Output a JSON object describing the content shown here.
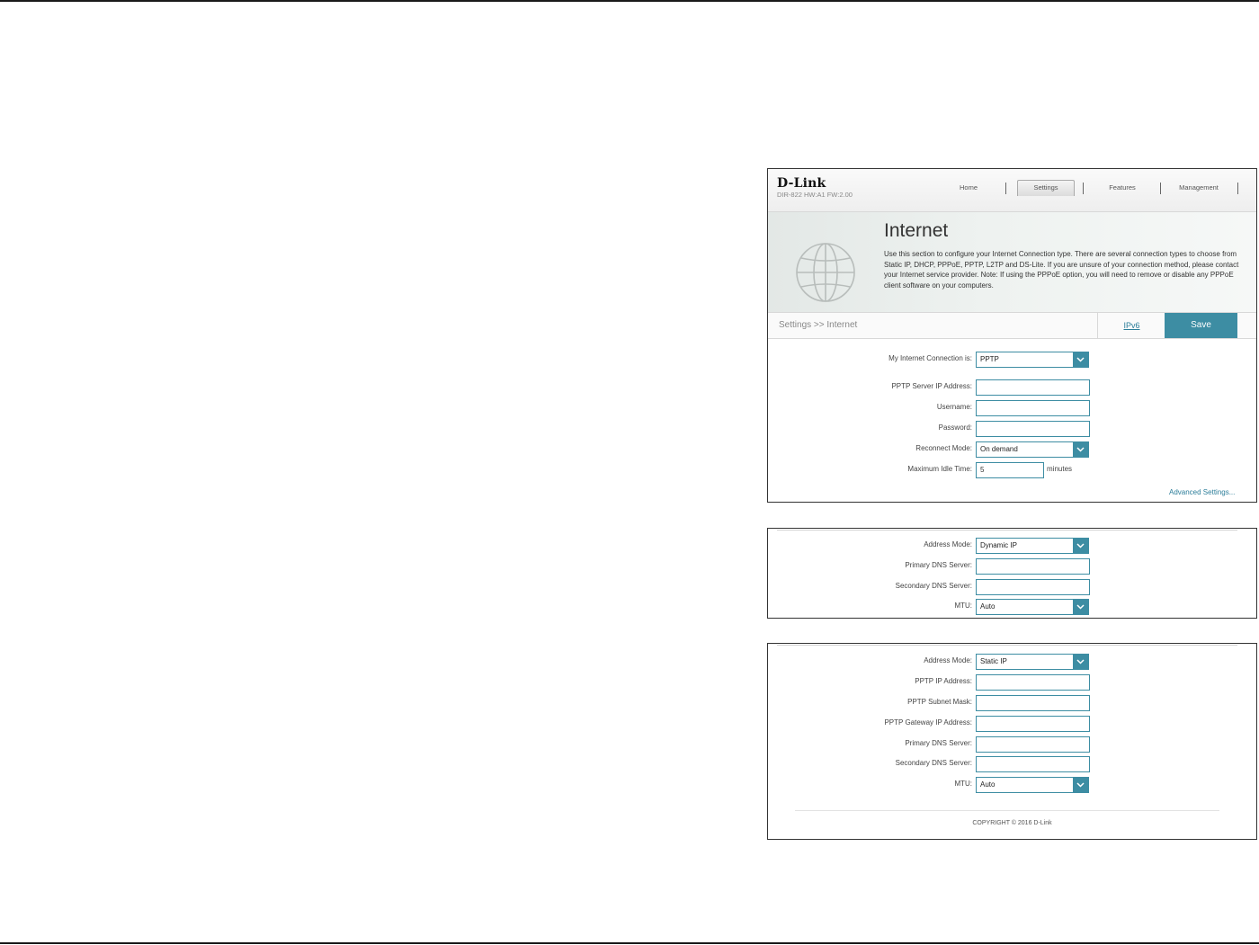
{
  "brand": {
    "logo": "D-Link",
    "firmware": "DIR-822 HW:A1 FW:2.00"
  },
  "nav": {
    "home": "Home",
    "settings": "Settings",
    "features": "Features",
    "management": "Management"
  },
  "banner": {
    "title": "Internet",
    "description": "Use this section to configure your Internet Connection type. There are several connection types to choose from Static IP, DHCP, PPPoE, PPTP, L2TP and DS-Lite. If you are unsure of your connection method, please contact your Internet service provider. Note: If using the PPPoE option, you will need to remove or disable any PPPoE client software on your computers."
  },
  "breadcrumb": "Settings >> Internet",
  "actions": {
    "ipv6": "IPv6",
    "save": "Save"
  },
  "main_form": {
    "connection_label": "My Internet Connection is:",
    "connection_value": "PPTP",
    "server_label": "PPTP Server IP Address:",
    "server_value": "",
    "username_label": "Username:",
    "username_value": "",
    "password_label": "Password:",
    "password_value": "",
    "reconnect_label": "Reconnect Mode:",
    "reconnect_value": "On demand",
    "idle_label": "Maximum Idle Time:",
    "idle_value": "5",
    "idle_unit": "minutes",
    "advanced_link": "Advanced Settings..."
  },
  "dynamic_form": {
    "mode_label": "Address Mode:",
    "mode_value": "Dynamic IP",
    "dns1_label": "Primary DNS Server:",
    "dns1_value": "",
    "dns2_label": "Secondary DNS Server:",
    "dns2_value": "",
    "mtu_label": "MTU:",
    "mtu_value": "Auto"
  },
  "static_form": {
    "mode_label": "Address Mode:",
    "mode_value": "Static IP",
    "ip_label": "PPTP IP Address:",
    "ip_value": "",
    "mask_label": "PPTP Subnet Mask:",
    "mask_value": "",
    "gateway_label": "PPTP Gateway IP Address:",
    "gateway_value": "",
    "dns1_label": "Primary DNS Server:",
    "dns1_value": "",
    "dns2_label": "Secondary DNS Server:",
    "dns2_value": "",
    "mtu_label": "MTU:",
    "mtu_value": "Auto"
  },
  "footer": {
    "copyright": "COPYRIGHT © 2016 D-Link"
  },
  "colors": {
    "accent": "#3d8da3",
    "link": "#2b7d99",
    "text": "#444444"
  }
}
